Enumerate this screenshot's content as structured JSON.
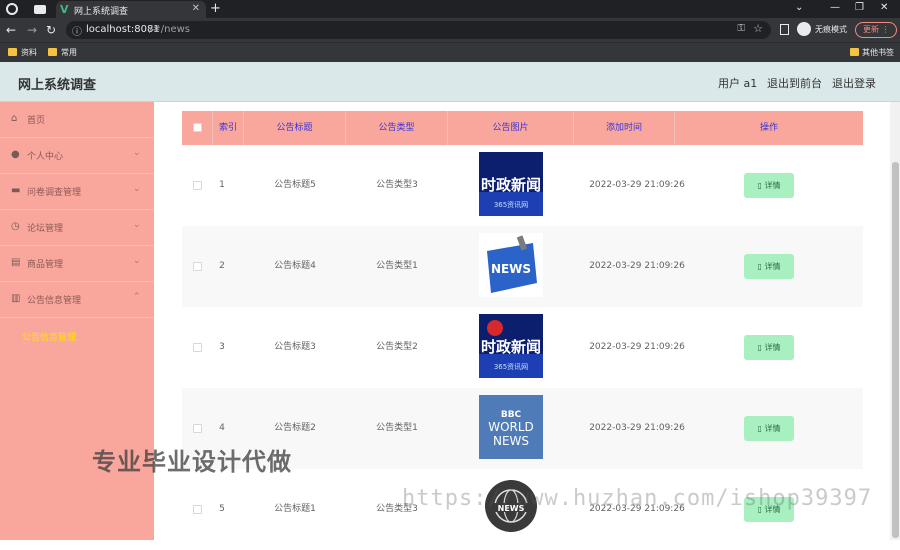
{
  "browser": {
    "tab_title": "网上系统调查",
    "url_host": "localhost:8081",
    "url_path": "/#/news",
    "incognito_label": "无痕模式",
    "update_label": "更新",
    "bookmarks": [
      "资料",
      "常用"
    ],
    "other_bookmarks": "其他书签"
  },
  "header": {
    "title": "网上系统调查",
    "user_label": "用户 a1",
    "back_front": "退出到前台",
    "logout": "退出登录"
  },
  "sidebar": {
    "items": [
      {
        "label": "首页",
        "icon": "home-icon",
        "has_chevron": false
      },
      {
        "label": "个人中心",
        "icon": "user-icon",
        "has_chevron": true
      },
      {
        "label": "问卷调查管理",
        "icon": "survey-icon",
        "has_chevron": true
      },
      {
        "label": "论坛管理",
        "icon": "clock-icon",
        "has_chevron": true
      },
      {
        "label": "商品管理",
        "icon": "store-icon",
        "has_chevron": true
      },
      {
        "label": "公告信息管理",
        "icon": "clipboard-icon",
        "has_chevron": true
      }
    ],
    "active_sub": "公告信息管理"
  },
  "table": {
    "headers": [
      "索引",
      "公告标题",
      "公告类型",
      "公告图片",
      "添加时间",
      "操作"
    ],
    "detail_label": "详情",
    "rows": [
      {
        "index": "1",
        "title": "公告标题5",
        "type": "公告类型3",
        "image": "时政新闻",
        "time": "2022-03-29 21:09:26"
      },
      {
        "index": "2",
        "title": "公告标题4",
        "type": "公告类型1",
        "image": "NEWS",
        "time": "2022-03-29 21:09:26"
      },
      {
        "index": "3",
        "title": "公告标题3",
        "type": "公告类型2",
        "image": "时政新闻",
        "time": "2022-03-29 21:09:26"
      },
      {
        "index": "4",
        "title": "公告标题2",
        "type": "公告类型1",
        "image": "BBC WORLD NEWS",
        "time": "2022-03-29 21:09:26"
      },
      {
        "index": "5",
        "title": "公告标题1",
        "type": "公告类型3",
        "image": "NEWS",
        "time": "2022-03-29 21:09:26"
      }
    ]
  },
  "image_labels": {
    "sub": "365资讯网",
    "bbc": "BBC",
    "world": "WORLD",
    "news": "NEWS"
  },
  "watermark": {
    "text1": "专业毕业设计代做",
    "text2": "https://www.huzhan.com/ishop39397"
  },
  "colors": {
    "sidebar": "#f9a79d",
    "header": "#dbe8e9",
    "table_header_text": "#3a34d6",
    "active_sub": "#ffe100",
    "detail_button": "#a8f0c0"
  }
}
